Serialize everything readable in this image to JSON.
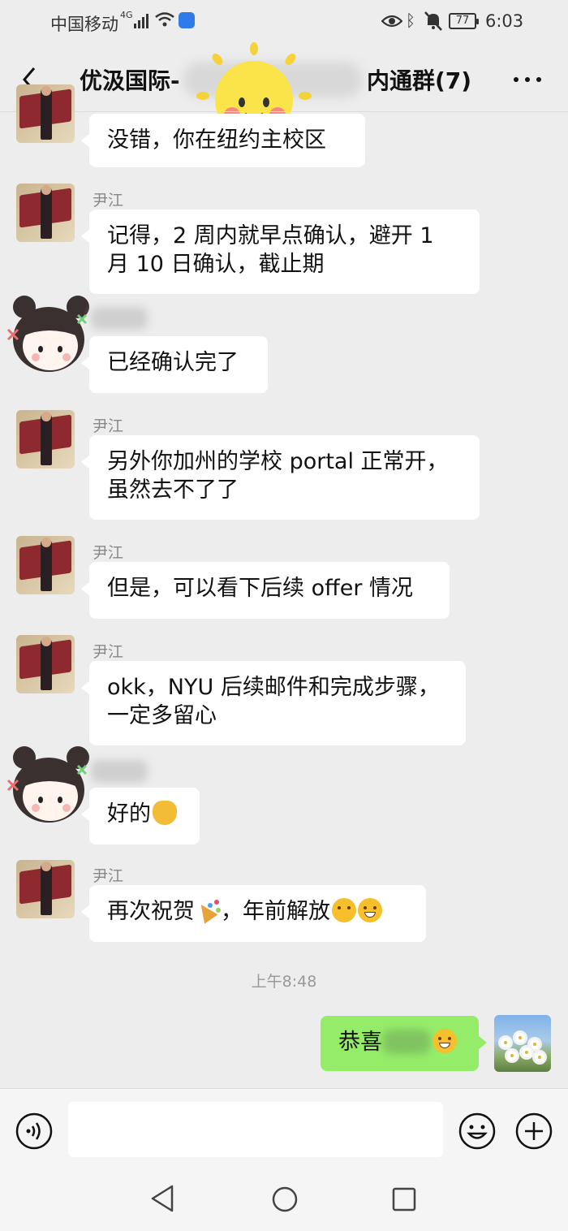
{
  "status_bar": {
    "carrier": "中国移动",
    "network": "4G",
    "battery": "77",
    "time": "6:03"
  },
  "header": {
    "title_start": "优汲国际-",
    "title_end": "内通群(7)"
  },
  "messages": [
    {
      "sender": "",
      "text": "没错，你在纽约主校区"
    },
    {
      "sender": "尹江",
      "line1": "记得，2 周内就早点确认，避开 1",
      "line2": "月 10 日确认，截止期"
    },
    {
      "sender": "",
      "text": "已经确认完了"
    },
    {
      "sender": "尹江",
      "line1": "另外你加州的学校 portal 正常开，",
      "line2": "虽然去不了了"
    },
    {
      "sender": "尹江",
      "text": "但是，可以看下后续 offer 情况"
    },
    {
      "sender": "尹江",
      "line1": "okk，NYU 后续邮件和完成步骤，",
      "line2": "一定多留心"
    },
    {
      "sender": "",
      "text": "好的"
    },
    {
      "sender": "尹江",
      "text_a": "再次祝贺",
      "text_b": "，年前解放"
    }
  ],
  "timestamp": "上午8:48",
  "my_message": {
    "text": "恭喜"
  },
  "icons": {
    "back": "back-arrow-icon",
    "more": "more-dots-icon",
    "voice": "voice-icon",
    "emoji": "emoji-icon",
    "plus": "plus-icon",
    "nav_back": "nav-back-icon",
    "nav_home": "nav-home-icon",
    "nav_recent": "nav-recent-icon"
  },
  "colors": {
    "background": "#ededed",
    "bubble_other": "#ffffff",
    "bubble_mine": "#95ec69",
    "sender_name": "#888888"
  }
}
